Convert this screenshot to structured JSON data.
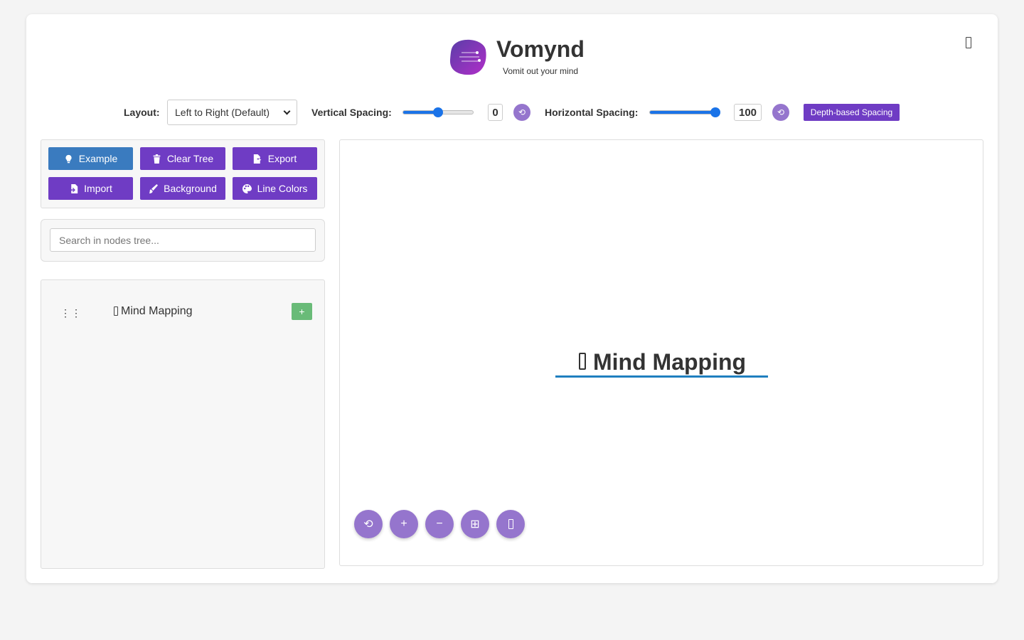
{
  "header": {
    "title": "Vomynd",
    "subtitle": "Vomit out your mind",
    "corner_icon": "unknown-glyph-icon"
  },
  "controls": {
    "layout_label": "Layout:",
    "layout_value": "Left to Right (Default)",
    "vertical_label": "Vertical Spacing:",
    "vertical_value": "0",
    "vertical_slider_fraction": 0.5,
    "horizontal_label": "Horizontal Spacing:",
    "horizontal_value": "100",
    "horizontal_slider_fraction": 1.0,
    "reset_symbol": "⟲",
    "depth_button": "Depth-based Spacing"
  },
  "actions": {
    "example": "Example",
    "clear_tree": "Clear Tree",
    "export": "Export",
    "import": "Import",
    "background": "Background",
    "line_colors": "Line Colors"
  },
  "search": {
    "placeholder": "Search in nodes tree..."
  },
  "tree": {
    "drag_symbol": "⋮⋮",
    "root_label": "Mind Mapping",
    "add_symbol": "+"
  },
  "canvas": {
    "root_label": "Mind Mapping",
    "root_underline_color": "#1f7fbf",
    "zoom_controls": {
      "reset": "⟲",
      "zoom_in": "+",
      "zoom_out": "−",
      "fit": "⊞"
    }
  },
  "colors": {
    "accent": "#6f3cc4",
    "accent_light": "#9575cd",
    "example_blue": "#3a7bbf",
    "add_green": "#69bb78",
    "slider_blue": "#1a73e8"
  }
}
